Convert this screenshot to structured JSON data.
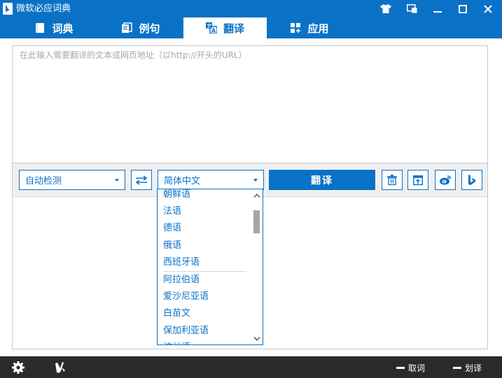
{
  "window": {
    "title": "微软必应词典",
    "controls": [
      "tshirt-icon",
      "miniwindow-icon",
      "minimize-icon",
      "maximize-icon",
      "close-icon"
    ]
  },
  "tabs": [
    {
      "label": "词典",
      "icon": "book-icon",
      "active": false
    },
    {
      "label": "例句",
      "icon": "pages-icon",
      "active": false
    },
    {
      "label": "翻译",
      "icon": "translate-icon",
      "active": true
    },
    {
      "label": "应用",
      "icon": "apps-icon",
      "active": false
    }
  ],
  "input": {
    "placeholder": "在此输入需要翻译的文本或网页地址（以http://开头的URL）",
    "value": ""
  },
  "toolbar": {
    "source_lang": "自动检测",
    "target_lang": "简体中文",
    "translate_label": "翻译",
    "buttons": [
      "swap-icon",
      "trash-icon",
      "export-icon",
      "weibo-icon",
      "bing-icon"
    ]
  },
  "language_list": {
    "items": [
      "朝鲜语",
      "法语",
      "德语",
      "俄语",
      "西班牙语",
      "阿拉伯语",
      "爱沙尼亚语",
      "白苗文",
      "保加利亚语",
      "波兰语"
    ],
    "separator_after": "西班牙语"
  },
  "statusbar": {
    "left_icons": [
      "gear-icon",
      "feedback-icon"
    ],
    "actions": [
      {
        "label": "取词"
      },
      {
        "label": "划译"
      }
    ]
  },
  "colors": {
    "accent": "#0a72c6",
    "statusbar": "#2b2b2b",
    "toolbar_bg": "#f0f0f0"
  }
}
